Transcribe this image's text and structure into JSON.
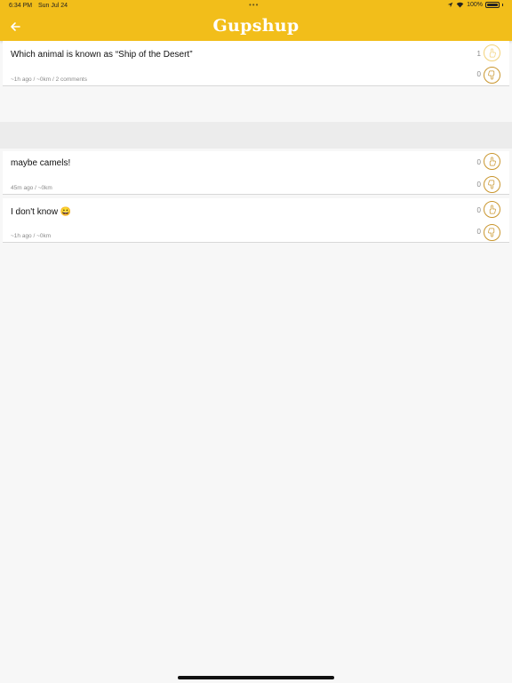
{
  "status_bar": {
    "time": "6:34 PM",
    "date": "Sun Jul 24",
    "dots": "•••",
    "battery": "100%"
  },
  "header": {
    "title": "Gupshup",
    "back_icon": "arrow-left-icon",
    "color": "#f2be1a"
  },
  "post": {
    "text": "Which animal is known as “Ship of the Desert”",
    "meta": "~1h ago / ~0km / 2 comments",
    "upvotes": "1",
    "downvotes": "0"
  },
  "comments": [
    {
      "text": "maybe camels!",
      "meta": "45m ago / ~0km",
      "upvotes": "0",
      "downvotes": "0"
    },
    {
      "text": "I don't know 😀",
      "meta": "~1h ago / ~0km",
      "upvotes": "0",
      "downvotes": "0"
    }
  ],
  "icons": {
    "upvote": "hand-point-up-icon",
    "downvote": "hand-point-down-icon"
  }
}
